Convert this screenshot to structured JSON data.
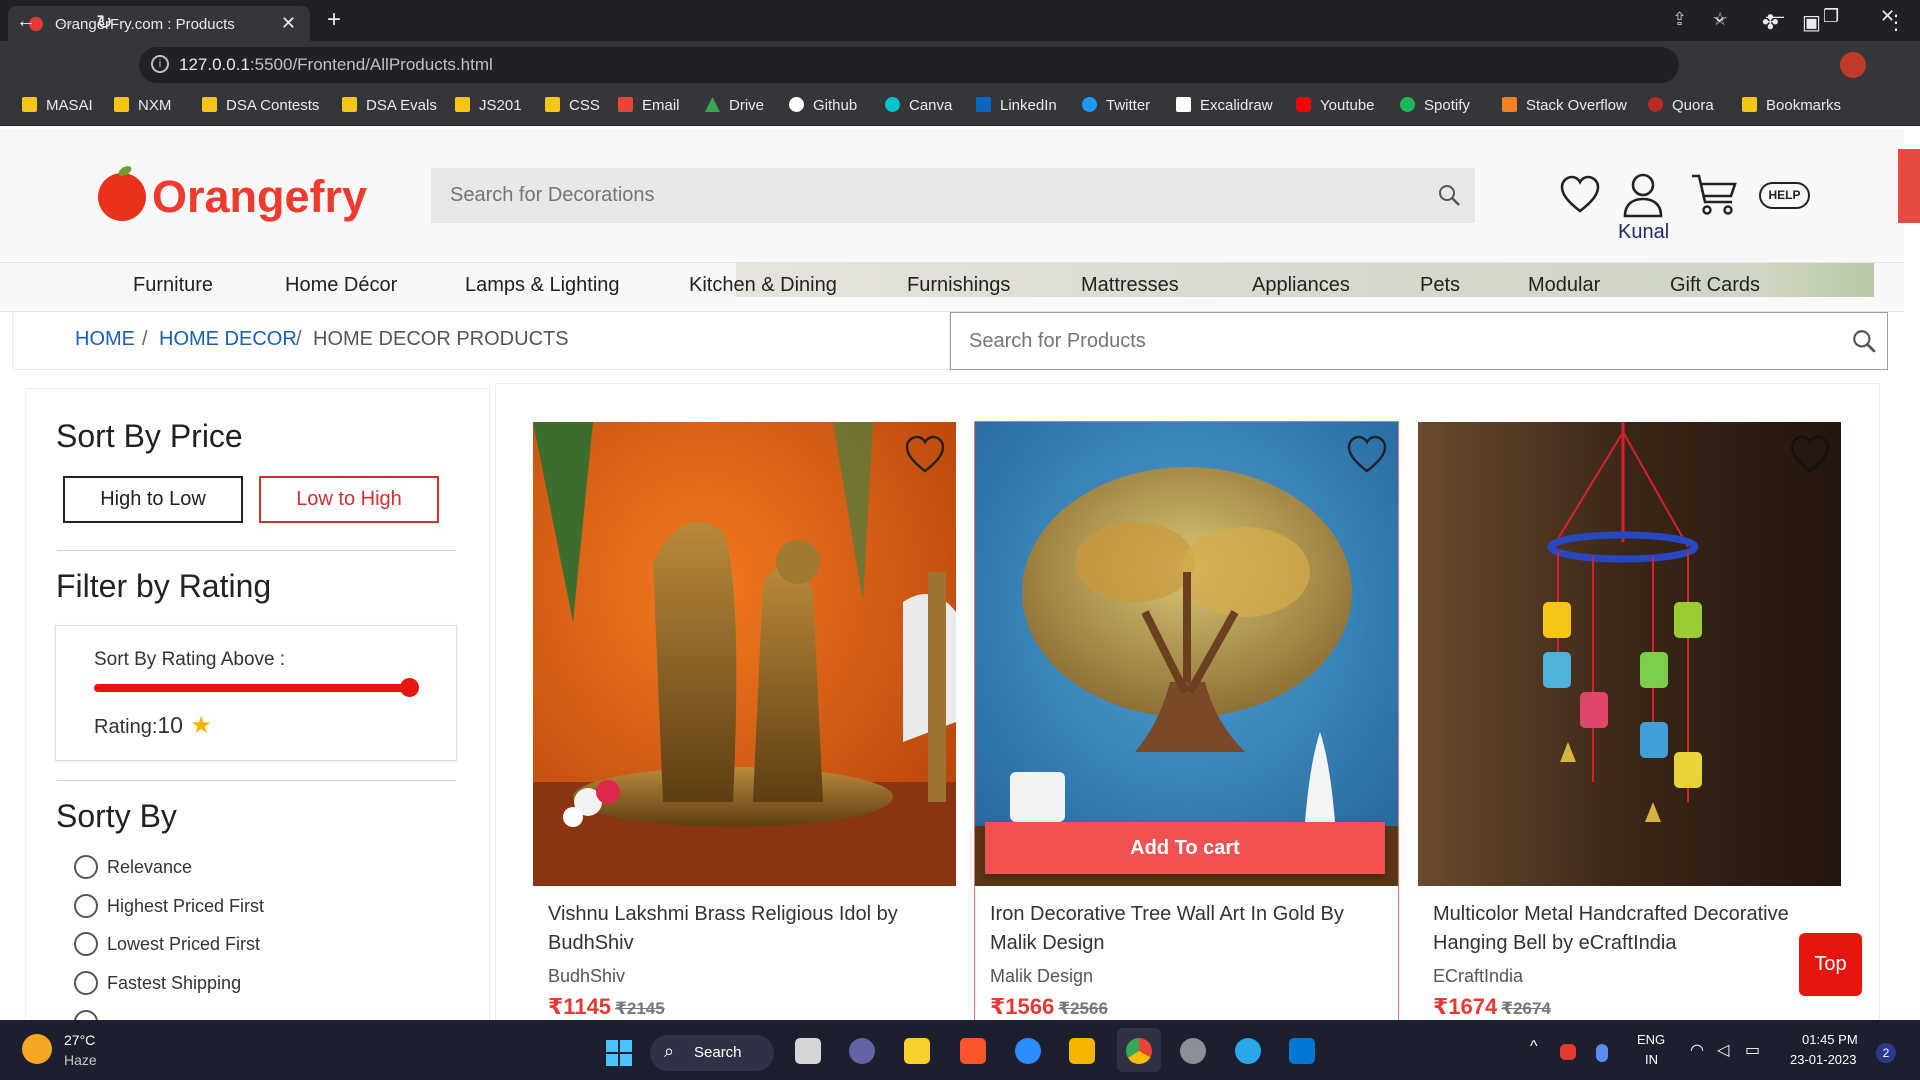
{
  "browser": {
    "tab_title": "OrangerFry.com : Products",
    "url_host": "127.0.0.1",
    "url_path": ":5500/Frontend/AllProducts.html",
    "bookmarks": [
      {
        "label": "MASAI",
        "icon": "folder-icon",
        "color": "#f5c518"
      },
      {
        "label": "NXM",
        "icon": "folder-icon",
        "color": "#f5c518"
      },
      {
        "label": "DSA Contests",
        "icon": "folder-icon",
        "color": "#f5c518"
      },
      {
        "label": "DSA Evals",
        "icon": "folder-icon",
        "color": "#f5c518"
      },
      {
        "label": "JS201",
        "icon": "folder-icon",
        "color": "#f5c518"
      },
      {
        "label": "CSS",
        "icon": "folder-icon",
        "color": "#f5c518"
      },
      {
        "label": "Email",
        "icon": "gmail-icon",
        "color": "#ea4335"
      },
      {
        "label": "Drive",
        "icon": "drive-icon",
        "color": "#34a853"
      },
      {
        "label": "Github",
        "icon": "github-icon",
        "color": "#ffffff"
      },
      {
        "label": "Canva",
        "icon": "canva-icon",
        "color": "#00c4cc"
      },
      {
        "label": "LinkedIn",
        "icon": "linkedin-icon",
        "color": "#0a66c2"
      },
      {
        "label": "Twitter",
        "icon": "twitter-icon",
        "color": "#1d9bf0"
      },
      {
        "label": "Excalidraw",
        "icon": "excalidraw-icon",
        "color": "#ffffff"
      },
      {
        "label": "Youtube",
        "icon": "youtube-icon",
        "color": "#ff0000"
      },
      {
        "label": "Spotify",
        "icon": "spotify-icon",
        "color": "#1db954"
      },
      {
        "label": "Stack Overflow",
        "icon": "stackoverflow-icon",
        "color": "#f48024"
      },
      {
        "label": "Quora",
        "icon": "quora-icon",
        "color": "#b92b27"
      },
      {
        "label": "Bookmarks",
        "icon": "folder-icon",
        "color": "#f5c518"
      }
    ]
  },
  "header": {
    "logo": "Orangefry",
    "search_placeholder": "Search for Decorations",
    "user_name": "Kunal",
    "help_label": "HELP"
  },
  "categories": [
    "Furniture",
    "Home Décor",
    "Lamps & Lighting",
    "Kitchen & Dining",
    "Furnishings",
    "Mattresses",
    "Appliances",
    "Pets",
    "Modular",
    "Gift Cards"
  ],
  "breadcrumb": {
    "home": "HOME",
    "sep1": "/",
    "section": "HOME DECOR",
    "sep2": "/",
    "current": "HOME DECOR PRODUCTS"
  },
  "product_search_placeholder": "Search for Products",
  "sidebar": {
    "sort_price_title": "Sort By Price",
    "high_to_low": "High to Low",
    "low_to_high": "Low to High",
    "rating_title": "Filter by Rating",
    "rating_label": "Sort By Rating Above :",
    "rating_prefix": "Rating:",
    "rating_value": "10",
    "rating_slider_fraction": 1.0,
    "sorty_title": "Sorty By",
    "sort_options": [
      "Relevance",
      "Highest Priced First",
      "Lowest Priced First",
      "Fastest Shipping"
    ]
  },
  "products": [
    {
      "title": "Vishnu Lakshmi Brass Religious Idol by BudhShiv",
      "brand": "BudhShiv",
      "price": "₹1145",
      "mrp": "₹2145"
    },
    {
      "title": "Iron Decorative Tree Wall Art In Gold By Malik Design",
      "brand": "Malik Design",
      "price": "₹1566",
      "mrp": "₹2566"
    },
    {
      "title": "Multicolor Metal Handcrafted Decorative Hanging Bell by eCraftIndia",
      "brand": "ECraftIndia",
      "price": "₹1674",
      "mrp": "₹2674"
    }
  ],
  "add_to_cart": "Add To cart",
  "top_button": "Top",
  "taskbar": {
    "temperature": "27°C",
    "weather": "Haze",
    "search_label": "Search",
    "lang1": "ENG",
    "lang2": "IN",
    "time": "01:45 PM",
    "date": "23-01-2023",
    "notification_count": "2"
  },
  "colors": {
    "brand": "#ef3a2c",
    "accent": "#e6150d",
    "link": "#1a5fb4"
  }
}
